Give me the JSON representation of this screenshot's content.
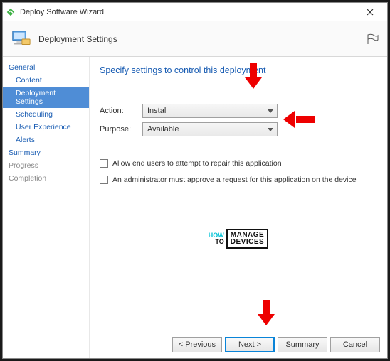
{
  "window": {
    "title": "Deploy Software Wizard"
  },
  "banner": {
    "title": "Deployment Settings"
  },
  "sidebar": {
    "groups": [
      {
        "label": "General",
        "items": [
          "Content",
          "Deployment Settings",
          "Scheduling",
          "User Experience",
          "Alerts"
        ]
      },
      {
        "label": "Summary",
        "items": []
      }
    ],
    "dim": [
      "Progress",
      "Completion"
    ],
    "selected": "Deployment Settings"
  },
  "content": {
    "heading": "Specify settings to control this deployment",
    "action_label": "Action:",
    "action_value": "Install",
    "purpose_label": "Purpose:",
    "purpose_value": "Available",
    "chk1": "Allow end users to attempt to repair this application",
    "chk2": "An administrator must approve a request for this application on the device"
  },
  "watermark": {
    "l1": "HOW",
    "l2": "TO",
    "r1": "MANAGE",
    "r2": "DEVICES"
  },
  "buttons": {
    "prev": "< Previous",
    "next": "Next >",
    "summary": "Summary",
    "cancel": "Cancel"
  }
}
